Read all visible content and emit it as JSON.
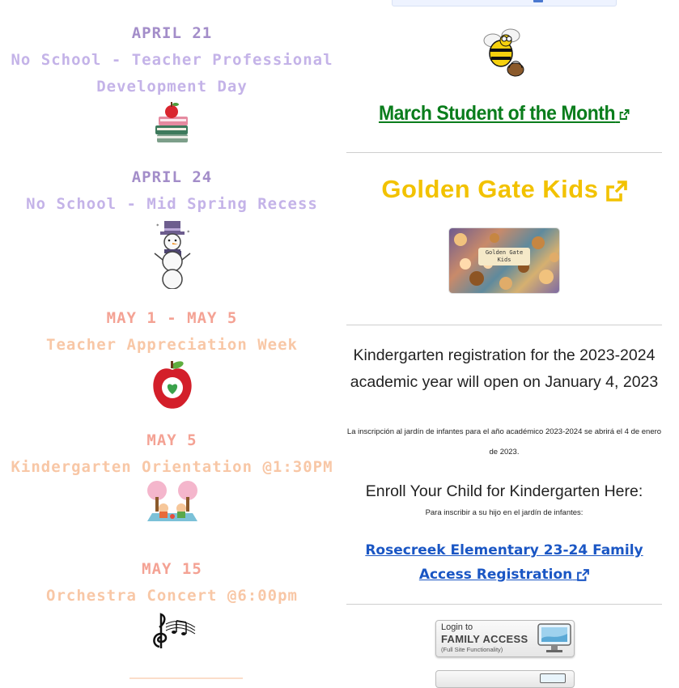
{
  "events": [
    {
      "date": "APRIL 21",
      "title_lines": [
        "No School - Teacher Professional",
        "Development Day"
      ],
      "icon": "books-apple-icon",
      "color": "purple"
    },
    {
      "date": "APRIL 24",
      "title_lines": [
        "No School - Mid Spring Recess"
      ],
      "icon": "snowman-icon",
      "color": "purple"
    },
    {
      "date": "MAY 1 - MAY 5",
      "title_lines": [
        "Teacher Appreciation Week"
      ],
      "icon": "apple-icon",
      "color": "salmon"
    },
    {
      "date": "MAY 5",
      "title_lines": [
        "Kindergarten Orientation @1:30PM"
      ],
      "icon": "kids-picnic-icon",
      "color": "salmon"
    },
    {
      "date": "MAY 15",
      "title_lines": [
        "Orchestra Concert @6:00pm"
      ],
      "icon": "music-notes-icon",
      "color": "salmon"
    }
  ],
  "sidebar": {
    "motm_link": "March Student of the Month",
    "ggk_link": "Golden Gate Kids",
    "ggk_image_text_1": "Golden Gate",
    "ggk_image_text_2": "Kids",
    "registration_text": "Kindergarten registration for the 2023-2024 academic year will open on January 4, 2023",
    "registration_text_es": "La inscripción al jardín de infantes para el año académico 2023-2024 se abrirá el 4 de enero de 2023.",
    "enroll_heading": "Enroll Your Child for Kindergarten Here:",
    "enroll_sub_es": "Para inscribir a su hijo en el jardín de infantes:",
    "family_access_link": "Rosecreek Elementary 23-24 Family Access Registration",
    "login_button": {
      "line1": "Login to",
      "line2": "FAMILY ACCESS",
      "line3": "(Full Site Functionality)"
    }
  },
  "colors": {
    "purple_date": "#a38dc9",
    "purple_title": "#c4b3e8",
    "salmon_date": "#f4a294",
    "salmon_title": "#f8c7a6",
    "motm_green": "#0a7d1c",
    "ggk_gold": "#f2c200",
    "link_blue": "#1a56c4"
  }
}
